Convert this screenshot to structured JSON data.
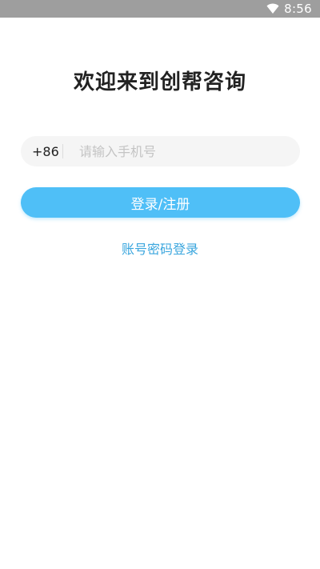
{
  "status_bar": {
    "time": "8:56",
    "wifi_icon": "wifi-icon"
  },
  "title": "欢迎来到创帮咨询",
  "phone": {
    "country_code": "+86",
    "value": "",
    "placeholder": "请输入手机号"
  },
  "login_button_label": "登录/注册",
  "password_login_link": "账号密码登录",
  "colors": {
    "accent": "#4fbff7",
    "link": "#3aa6de",
    "status_bar": "#9e9e9e"
  }
}
